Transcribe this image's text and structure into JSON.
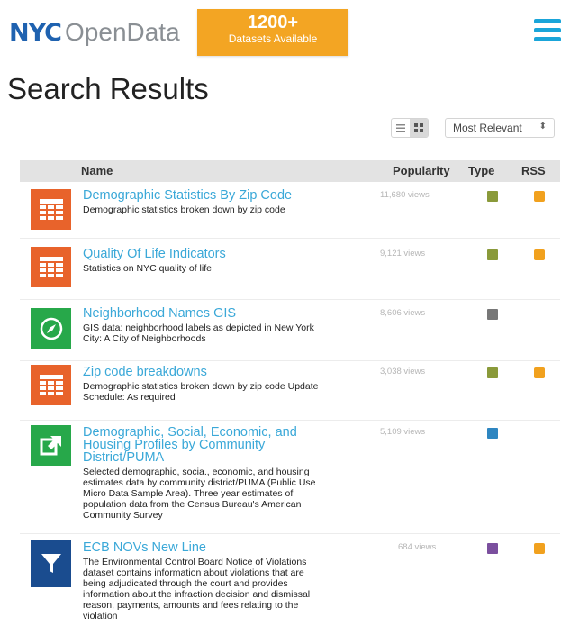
{
  "header": {
    "logo_nyc": "NYC",
    "logo_opendata": "OpenData",
    "banner_count": "1200+",
    "banner_sub": "Datasets Available"
  },
  "page_title": "Search Results",
  "controls": {
    "sort_selected": "Most Relevant",
    "sort_arrow": "⬍"
  },
  "table": {
    "headers": {
      "name": "Name",
      "popularity": "Popularity",
      "type": "Type",
      "rss": "RSS"
    },
    "rows": [
      {
        "title": "Demographic Statistics By Zip Code",
        "description": "Demographic statistics broken down by zip code",
        "views": "11,680 views",
        "icon": "table-icon",
        "type_color": "#8a9a3a",
        "rss": true
      },
      {
        "title": "Quality Of Life Indicators",
        "description": "Statistics on NYC quality of life",
        "views": "9,121 views",
        "icon": "table-icon",
        "type_color": "#8a9a3a",
        "rss": true
      },
      {
        "title": "Neighborhood Names GIS",
        "description": "GIS data: neighborhood labels as depicted in New York City: A City of Neighborhoods",
        "views": "8,606 views",
        "icon": "compass-icon",
        "type_color": "#777777",
        "rss": false
      },
      {
        "title": "Zip code breakdowns",
        "description": "Demographic statistics broken down by zip code Update Schedule: As required",
        "views": "3,038 views",
        "icon": "table-icon",
        "type_color": "#8a9a3a",
        "rss": true
      },
      {
        "title": "Demographic, Social, Economic, and Housing Profiles by Community District/PUMA",
        "description": "Selected demographic, socia., economic, and housing estimates data by community district/PUMA (Public Use Micro Data Sample Area). Three year estimates of population data from the Census Bureau's American Community Survey",
        "views": "5,109 views",
        "icon": "external-link-icon",
        "type_color": "#2e86c1",
        "rss": false
      },
      {
        "title": "ECB NOVs New Line",
        "description": "The Environmental Control Board Notice of Violations dataset contains information about violations that are being adjudicated through the court and provides information about the infraction decision and dismissal reason, payments, amounts and fees relating to the violation",
        "views": "684 views",
        "icon": "filter-icon",
        "type_color": "#7b4f9e",
        "rss": true
      }
    ]
  }
}
